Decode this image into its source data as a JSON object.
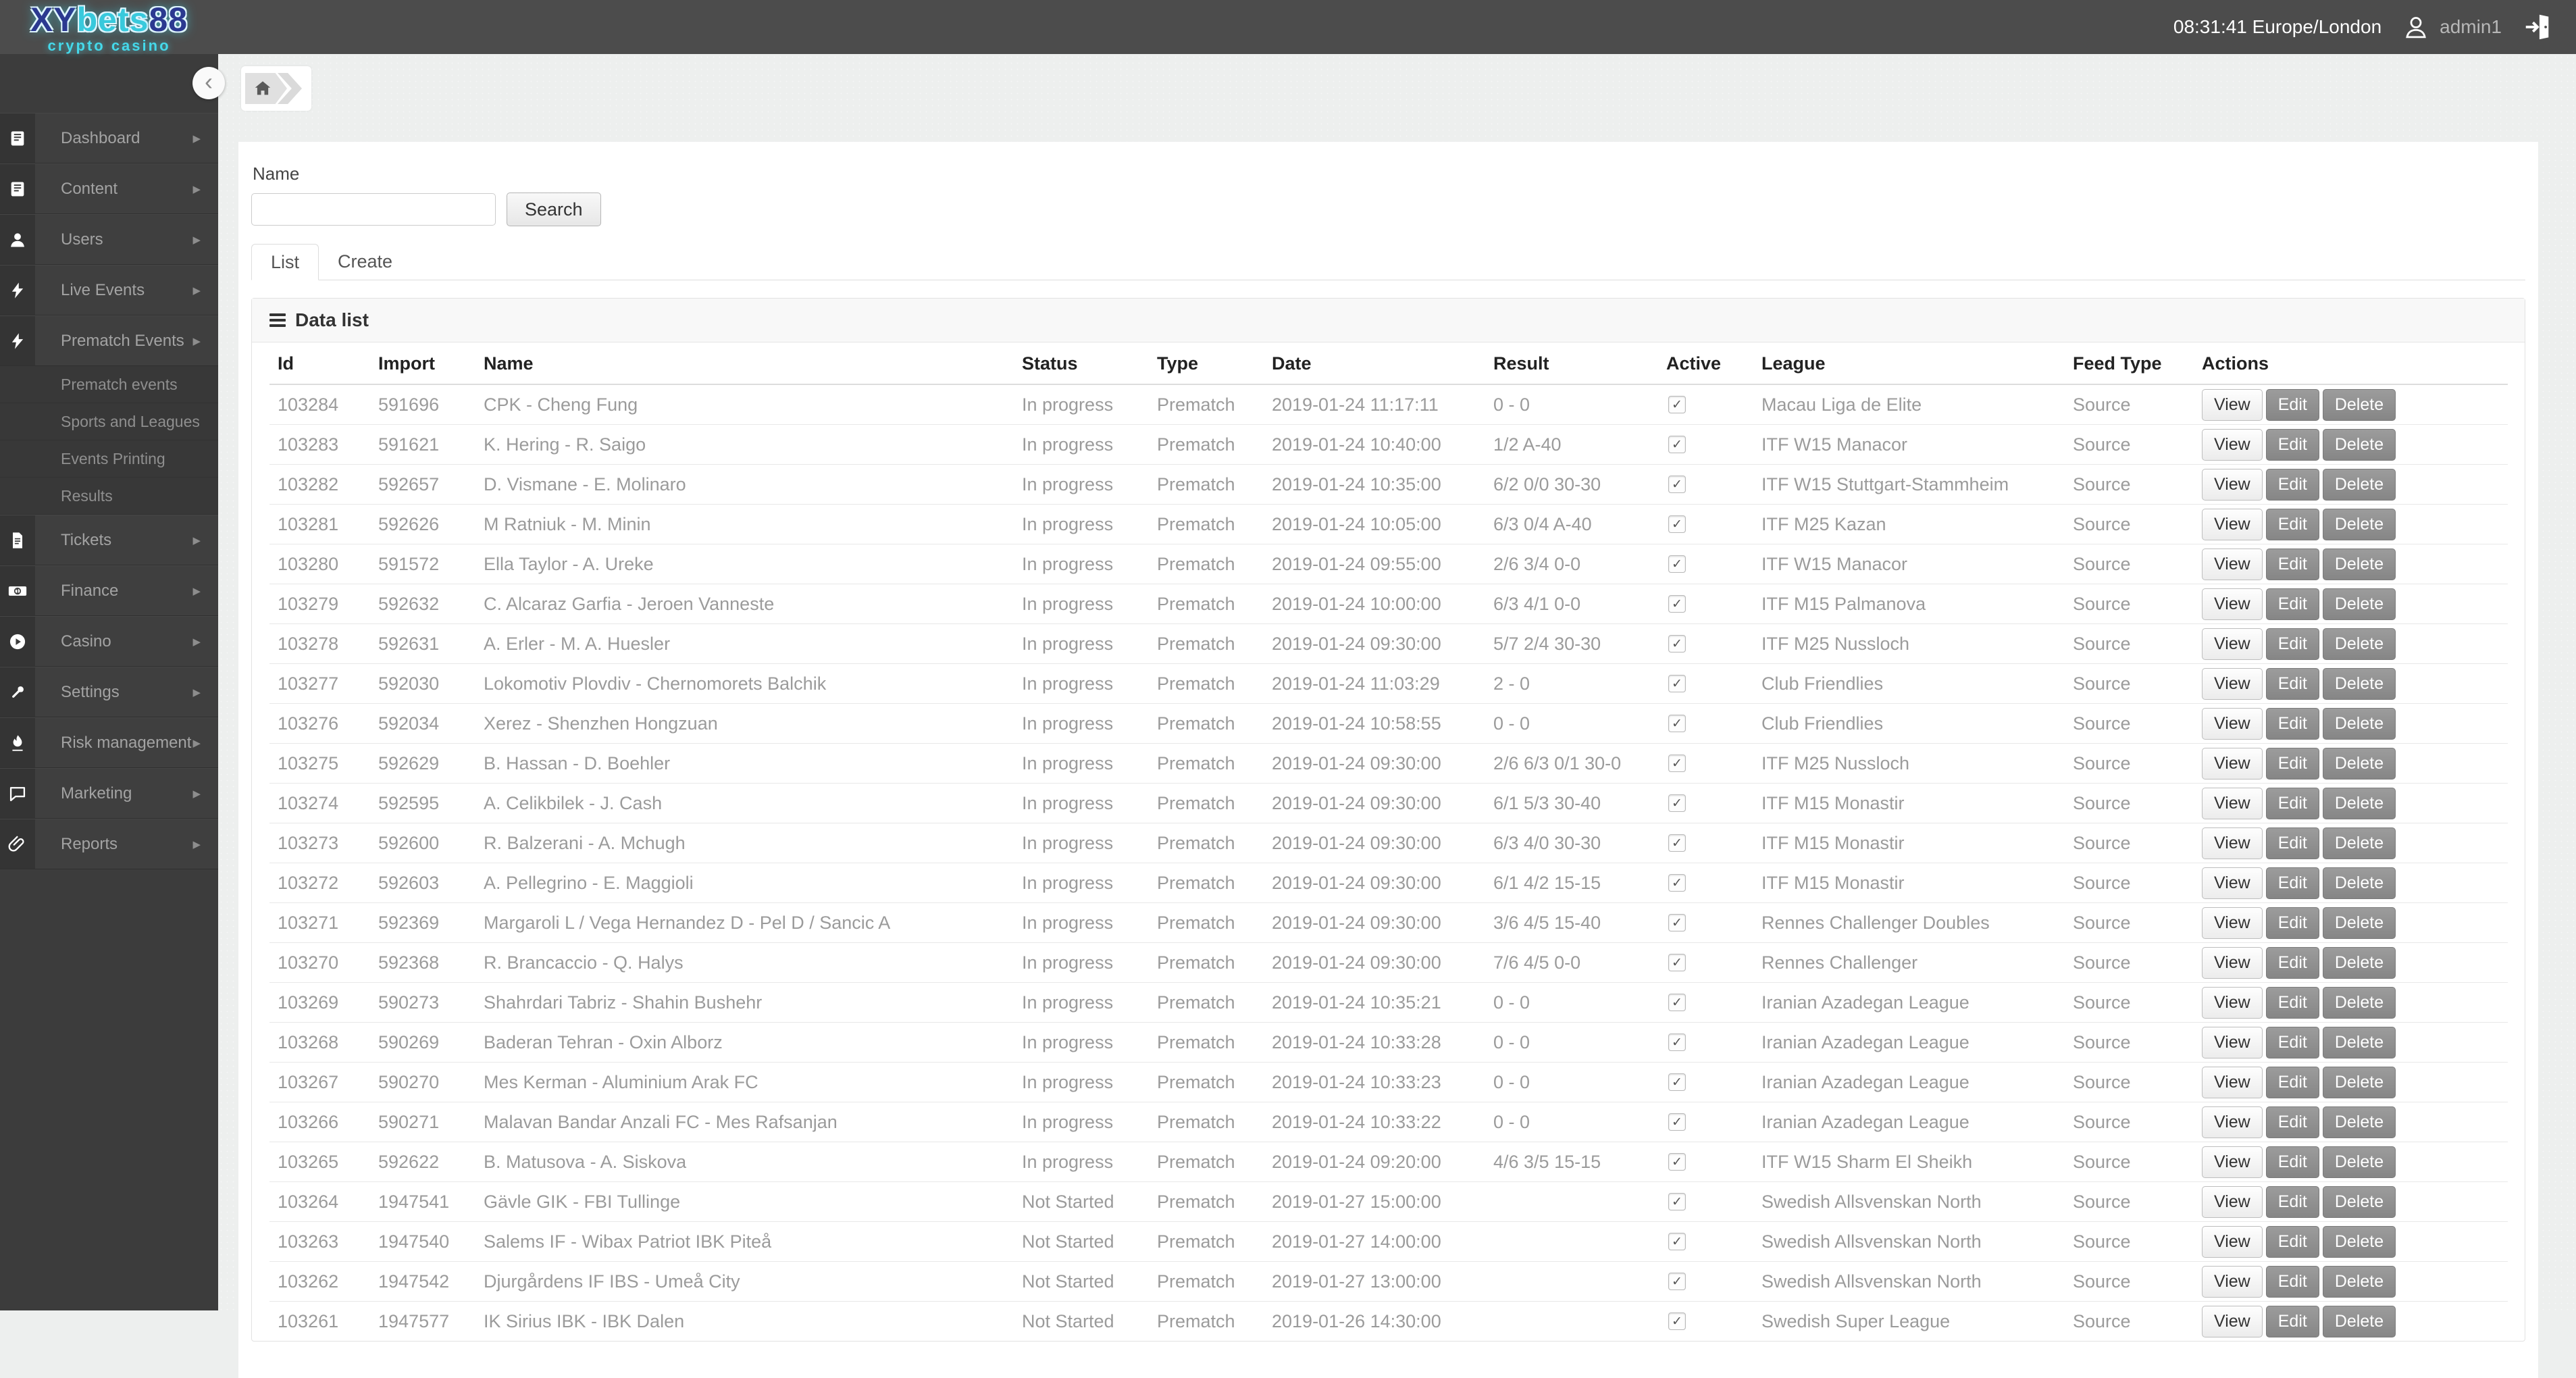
{
  "brand": {
    "name_prefix": "XY",
    "name_mid": "bets",
    "name_suffix": "88",
    "tagline": "crypto casino"
  },
  "header": {
    "clock": "08:31:41 Europe/London",
    "username": "admin1",
    "user_icon": "user-icon",
    "logout_icon": "logout-icon"
  },
  "breadcrumb": {
    "home_icon": "home-icon"
  },
  "sidebar": {
    "collapse_icon": "chevron-left-icon",
    "items": [
      {
        "label": "Dashboard",
        "icon": "book-icon"
      },
      {
        "label": "Content",
        "icon": "book-icon"
      },
      {
        "label": "Users",
        "icon": "user-icon"
      },
      {
        "label": "Live Events",
        "icon": "bolt-icon"
      },
      {
        "label": "Prematch Events",
        "icon": "bolt-icon",
        "children": [
          "Prematch events",
          "Sports and Leagues",
          "Events Printing",
          "Results"
        ]
      },
      {
        "label": "Tickets",
        "icon": "file-icon"
      },
      {
        "label": "Finance",
        "icon": "money-icon"
      },
      {
        "label": "Casino",
        "icon": "play-icon"
      },
      {
        "label": "Settings",
        "icon": "wrench-icon"
      },
      {
        "label": "Risk management",
        "icon": "flame-icon"
      },
      {
        "label": "Marketing",
        "icon": "chat-icon"
      },
      {
        "label": "Reports",
        "icon": "paperclip-icon"
      }
    ]
  },
  "filter": {
    "label": "Name",
    "value": "",
    "button": "Search"
  },
  "tabs": [
    {
      "label": "List",
      "active": true
    },
    {
      "label": "Create",
      "active": false
    }
  ],
  "panel": {
    "title": "Data list",
    "menu_icon": "hamburger-icon"
  },
  "table": {
    "columns": [
      "Id",
      "Import",
      "Name",
      "Status",
      "Type",
      "Date",
      "Result",
      "Active",
      "League",
      "Feed Type",
      "Actions"
    ],
    "action_buttons": [
      "View",
      "Edit",
      "Delete"
    ],
    "rows": [
      {
        "id": "103284",
        "import": "591696",
        "name": "CPK - Cheng Fung",
        "status": "In progress",
        "type": "Prematch",
        "date": "2019-01-24 11:17:11",
        "result": "0 - 0",
        "active": true,
        "league": "Macau Liga de Elite",
        "feed_type": "Source"
      },
      {
        "id": "103283",
        "import": "591621",
        "name": "K. Hering - R. Saigo",
        "status": "In progress",
        "type": "Prematch",
        "date": "2019-01-24 10:40:00",
        "result": "1/2 A-40",
        "active": true,
        "league": "ITF W15 Manacor",
        "feed_type": "Source"
      },
      {
        "id": "103282",
        "import": "592657",
        "name": "D. Vismane - E. Molinaro",
        "status": "In progress",
        "type": "Prematch",
        "date": "2019-01-24 10:35:00",
        "result": "6/2 0/0 30-30",
        "active": true,
        "league": "ITF W15 Stuttgart-Stammheim",
        "feed_type": "Source"
      },
      {
        "id": "103281",
        "import": "592626",
        "name": "M Ratniuk - M. Minin",
        "status": "In progress",
        "type": "Prematch",
        "date": "2019-01-24 10:05:00",
        "result": "6/3 0/4 A-40",
        "active": true,
        "league": "ITF M25 Kazan",
        "feed_type": "Source"
      },
      {
        "id": "103280",
        "import": "591572",
        "name": "Ella Taylor - A. Ureke",
        "status": "In progress",
        "type": "Prematch",
        "date": "2019-01-24 09:55:00",
        "result": "2/6 3/4 0-0",
        "active": true,
        "league": "ITF W15 Manacor",
        "feed_type": "Source"
      },
      {
        "id": "103279",
        "import": "592632",
        "name": "C. Alcaraz Garfia - Jeroen Vanneste",
        "status": "In progress",
        "type": "Prematch",
        "date": "2019-01-24 10:00:00",
        "result": "6/3 4/1 0-0",
        "active": true,
        "league": "ITF M15 Palmanova",
        "feed_type": "Source"
      },
      {
        "id": "103278",
        "import": "592631",
        "name": "A. Erler - M. A. Huesler",
        "status": "In progress",
        "type": "Prematch",
        "date": "2019-01-24 09:30:00",
        "result": "5/7 2/4 30-30",
        "active": true,
        "league": "ITF M25 Nussloch",
        "feed_type": "Source"
      },
      {
        "id": "103277",
        "import": "592030",
        "name": "Lokomotiv Plovdiv - Chernomorets Balchik",
        "status": "In progress",
        "type": "Prematch",
        "date": "2019-01-24 11:03:29",
        "result": "2 - 0",
        "active": true,
        "league": "Club Friendlies",
        "feed_type": "Source"
      },
      {
        "id": "103276",
        "import": "592034",
        "name": "Xerez - Shenzhen Hongzuan",
        "status": "In progress",
        "type": "Prematch",
        "date": "2019-01-24 10:58:55",
        "result": "0 - 0",
        "active": true,
        "league": "Club Friendlies",
        "feed_type": "Source"
      },
      {
        "id": "103275",
        "import": "592629",
        "name": "B. Hassan - D. Boehler",
        "status": "In progress",
        "type": "Prematch",
        "date": "2019-01-24 09:30:00",
        "result": "2/6 6/3 0/1 30-0",
        "active": true,
        "league": "ITF M25 Nussloch",
        "feed_type": "Source"
      },
      {
        "id": "103274",
        "import": "592595",
        "name": "A. Celikbilek - J. Cash",
        "status": "In progress",
        "type": "Prematch",
        "date": "2019-01-24 09:30:00",
        "result": "6/1 5/3 30-40",
        "active": true,
        "league": "ITF M15 Monastir",
        "feed_type": "Source"
      },
      {
        "id": "103273",
        "import": "592600",
        "name": "R. Balzerani - A. Mchugh",
        "status": "In progress",
        "type": "Prematch",
        "date": "2019-01-24 09:30:00",
        "result": "6/3 4/0 30-30",
        "active": true,
        "league": "ITF M15 Monastir",
        "feed_type": "Source"
      },
      {
        "id": "103272",
        "import": "592603",
        "name": "A. Pellegrino - E. Maggioli",
        "status": "In progress",
        "type": "Prematch",
        "date": "2019-01-24 09:30:00",
        "result": "6/1 4/2 15-15",
        "active": true,
        "league": "ITF M15 Monastir",
        "feed_type": "Source"
      },
      {
        "id": "103271",
        "import": "592369",
        "name": "Margaroli L / Vega Hernandez D - Pel D / Sancic A",
        "status": "In progress",
        "type": "Prematch",
        "date": "2019-01-24 09:30:00",
        "result": "3/6 4/5 15-40",
        "active": true,
        "league": "Rennes Challenger Doubles",
        "feed_type": "Source"
      },
      {
        "id": "103270",
        "import": "592368",
        "name": "R. Brancaccio - Q. Halys",
        "status": "In progress",
        "type": "Prematch",
        "date": "2019-01-24 09:30:00",
        "result": "7/6 4/5 0-0",
        "active": true,
        "league": "Rennes Challenger",
        "feed_type": "Source"
      },
      {
        "id": "103269",
        "import": "590273",
        "name": "Shahrdari Tabriz - Shahin Bushehr",
        "status": "In progress",
        "type": "Prematch",
        "date": "2019-01-24 10:35:21",
        "result": "0 - 0",
        "active": true,
        "league": "Iranian Azadegan League",
        "feed_type": "Source"
      },
      {
        "id": "103268",
        "import": "590269",
        "name": "Baderan Tehran - Oxin Alborz",
        "status": "In progress",
        "type": "Prematch",
        "date": "2019-01-24 10:33:28",
        "result": "0 - 0",
        "active": true,
        "league": "Iranian Azadegan League",
        "feed_type": "Source"
      },
      {
        "id": "103267",
        "import": "590270",
        "name": "Mes Kerman - Aluminium Arak FC",
        "status": "In progress",
        "type": "Prematch",
        "date": "2019-01-24 10:33:23",
        "result": "0 - 0",
        "active": true,
        "league": "Iranian Azadegan League",
        "feed_type": "Source"
      },
      {
        "id": "103266",
        "import": "590271",
        "name": "Malavan Bandar Anzali FC - Mes Rafsanjan",
        "status": "In progress",
        "type": "Prematch",
        "date": "2019-01-24 10:33:22",
        "result": "0 - 0",
        "active": true,
        "league": "Iranian Azadegan League",
        "feed_type": "Source"
      },
      {
        "id": "103265",
        "import": "592622",
        "name": "B. Matusova - A. Siskova",
        "status": "In progress",
        "type": "Prematch",
        "date": "2019-01-24 09:20:00",
        "result": "4/6 3/5 15-15",
        "active": true,
        "league": "ITF W15 Sharm El Sheikh",
        "feed_type": "Source"
      },
      {
        "id": "103264",
        "import": "1947541",
        "name": "Gävle GIK - FBI Tullinge",
        "status": "Not Started",
        "type": "Prematch",
        "date": "2019-01-27 15:00:00",
        "result": "",
        "active": true,
        "league": "Swedish Allsvenskan North",
        "feed_type": "Source"
      },
      {
        "id": "103263",
        "import": "1947540",
        "name": "Salems IF - Wibax Patriot IBK Piteå",
        "status": "Not Started",
        "type": "Prematch",
        "date": "2019-01-27 14:00:00",
        "result": "",
        "active": true,
        "league": "Swedish Allsvenskan North",
        "feed_type": "Source"
      },
      {
        "id": "103262",
        "import": "1947542",
        "name": "Djurgårdens IF IBS - Umeå City",
        "status": "Not Started",
        "type": "Prematch",
        "date": "2019-01-27 13:00:00",
        "result": "",
        "active": true,
        "league": "Swedish Allsvenskan North",
        "feed_type": "Source"
      },
      {
        "id": "103261",
        "import": "1947577",
        "name": "IK Sirius IBK - IBK Dalen",
        "status": "Not Started",
        "type": "Prematch",
        "date": "2019-01-26 14:30:00",
        "result": "",
        "active": true,
        "league": "Swedish Super League",
        "feed_type": "Source"
      }
    ]
  },
  "colors": {
    "header_bg": "#4c4c4c",
    "sidebar_bg": "#3c3c3c",
    "content_bg": "#edefee",
    "logo_navy": "#2b3990",
    "logo_teal": "#38c9dc",
    "button_gray": "#8f8f8f"
  }
}
